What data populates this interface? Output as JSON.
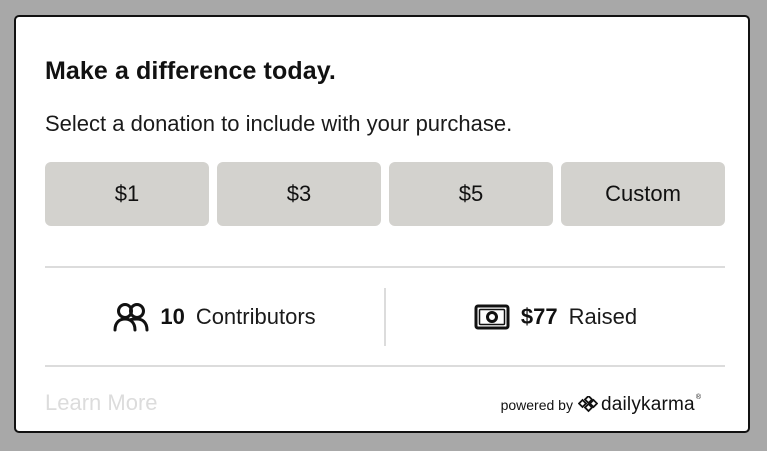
{
  "widget": {
    "title": "Make a difference today.",
    "subtitle": "Select a donation to include with your purchase.",
    "amounts": [
      {
        "label": "$1"
      },
      {
        "label": "$3"
      },
      {
        "label": "$5"
      },
      {
        "label": "Custom"
      }
    ],
    "stats": {
      "contributors": {
        "count": "10",
        "label": "Contributors",
        "icon": "users-icon"
      },
      "raised": {
        "amount": "$77",
        "label": "Raised",
        "icon": "cash-icon"
      }
    },
    "footer": {
      "learn_more": "Learn More",
      "powered_by": "powered by",
      "brand": "dailykarma",
      "brand_mark": "®"
    },
    "colors": {
      "button_bg": "#d3d2ce",
      "text": "#111111",
      "divider": "#dcdcdc",
      "muted_link": "#dcdcdc",
      "backdrop": "#a8a8a8"
    }
  }
}
